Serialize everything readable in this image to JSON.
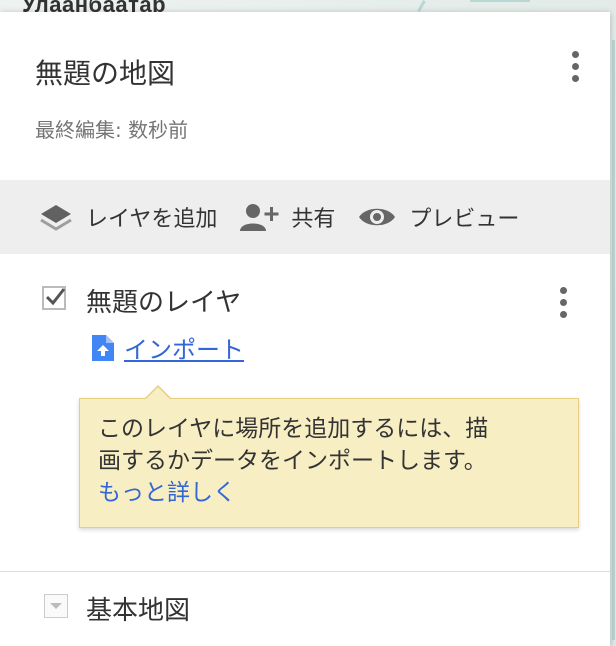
{
  "map": {
    "city_label": "Улаанбаатар"
  },
  "panel": {
    "title": "無題の地図",
    "subtitle": "最終編集: 数秒前"
  },
  "toolbar": {
    "add_layer": "レイヤを追加",
    "share": "共有",
    "preview": "プレビュー"
  },
  "layer": {
    "checked": true,
    "title": "無題のレイヤ",
    "import_label": "インポート"
  },
  "tooltip": {
    "line1": "このレイヤに場所を追加するには、描",
    "line2": "画するかデータをインポートします。",
    "link": "もっと詳しく"
  },
  "basemap": {
    "title": "基本地図"
  },
  "colors": {
    "link": "#3367d6",
    "toolbar_bg": "#eeeeee",
    "tooltip_bg": "#f7eec4"
  },
  "icons": [
    "layers-icon",
    "add-person-icon",
    "eye-icon",
    "kebab-menu-icon",
    "checkbox-icon",
    "import-file-icon",
    "chevron-down-icon"
  ]
}
